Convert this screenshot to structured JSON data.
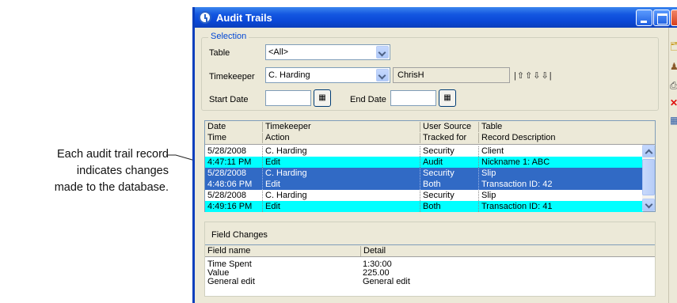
{
  "callout": {
    "line1": "Each audit trail record",
    "line2": "indicates changes",
    "line3": "made to the database."
  },
  "window": {
    "title": "Audit Trails"
  },
  "selection": {
    "legend": "Selection",
    "table_label": "Table",
    "table_value": "<All>",
    "timekeeper_label": "Timekeeper",
    "timekeeper_value": "C. Harding",
    "timekeeper_id": "ChrisH",
    "start_date_label": "Start Date",
    "end_date_label": "End Date"
  },
  "grid": {
    "headers_top": [
      "Date",
      "Timekeeper",
      "User Source",
      "Table"
    ],
    "headers_bottom": [
      "Time",
      "Action",
      "Tracked for",
      "Record Description"
    ],
    "rows": [
      [
        "5/28/2008",
        "C. Harding",
        "Security",
        "Client"
      ],
      [
        "4:47:11 PM",
        "Edit",
        "Audit",
        "Nickname 1: ABC"
      ],
      [
        "5/28/2008",
        "C. Harding",
        "Security",
        "Slip"
      ],
      [
        "4:48:06 PM",
        "Edit",
        "Both",
        "Transaction ID: 42"
      ],
      [
        "5/28/2008",
        "C. Harding",
        "Security",
        "Slip"
      ],
      [
        "4:49:16 PM",
        "Edit",
        "Both",
        "Transaction ID: 41"
      ]
    ]
  },
  "field_changes": {
    "title": "Field Changes",
    "headers": [
      "Field name",
      "Detail"
    ],
    "rows": [
      [
        "Time Spent",
        "1:30:00"
      ],
      [
        "Value",
        "225.00"
      ],
      [
        "General edit",
        "General edit"
      ]
    ]
  },
  "colors": {
    "title_bar": "#0a47d6",
    "highlight_row": "#00ffff",
    "selected_row": "#316ac5",
    "legend_text": "#0046d5"
  },
  "icons": [
    "folder-open-icon",
    "person-icon",
    "print-icon",
    "delete-icon",
    "report-icon",
    "calendar-icon",
    "first-record-icon",
    "prev-record-icon",
    "next-record-icon",
    "last-record-icon"
  ]
}
